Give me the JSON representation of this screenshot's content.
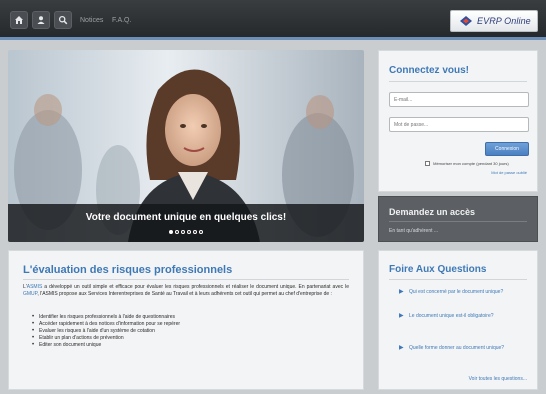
{
  "nav": {
    "links": [
      "Notices",
      "F.A.Q."
    ],
    "brand_text": "EVRP Online"
  },
  "hero": {
    "caption": "Votre document unique en quelques clics!",
    "slides": 6,
    "active_slide": 1
  },
  "login": {
    "title": "Connectez vous!",
    "email_placeholder": "E-mail...",
    "password_placeholder": "Mot de passe...",
    "submit_label": "Connexion",
    "remember_label": "Mémoriser mon compte (pendant 30 jours)",
    "forgot_label": "Mot de passe oublié"
  },
  "access": {
    "title": "Demandez un accès",
    "link": "En tant qu'adhérent ..."
  },
  "evaluation": {
    "title": "L'évaluation des risques professionnels",
    "para_1": "L'",
    "para_link_1": "ASMIS",
    "para_2": " a développé un outil simple et efficace pour évaluer les risques professionnels et réaliser le document unique. En partenariat avec le ",
    "para_link_2": "GMUP",
    "para_3": ", l'ASMIS propose aux Services Interentreprises de Santé au Travail et à leurs adhérents cet outil qui permet au chef d'entreprise de :",
    "list": [
      "Identifier les risques professionnels à l'aide de questionnaires",
      "Accéder rapidement à des notices d'information pour se repérer",
      "Evaluer les risques à l'aide d'un système de cotation",
      "Etablir un plan d'actions de prévention",
      "Editer son document unique"
    ]
  },
  "faq": {
    "title": "Foire Aux Questions",
    "items": [
      "Qui est concerné par le document unique?",
      "Le document unique est-il obligatoire?",
      "Quelle forme donner au document unique?"
    ],
    "see_all": "Voir toutes les questions..."
  },
  "colors": {
    "accent": "#3e79b7",
    "nav_bg": "#2e3134",
    "nav_rule": "#6d8fb7"
  }
}
